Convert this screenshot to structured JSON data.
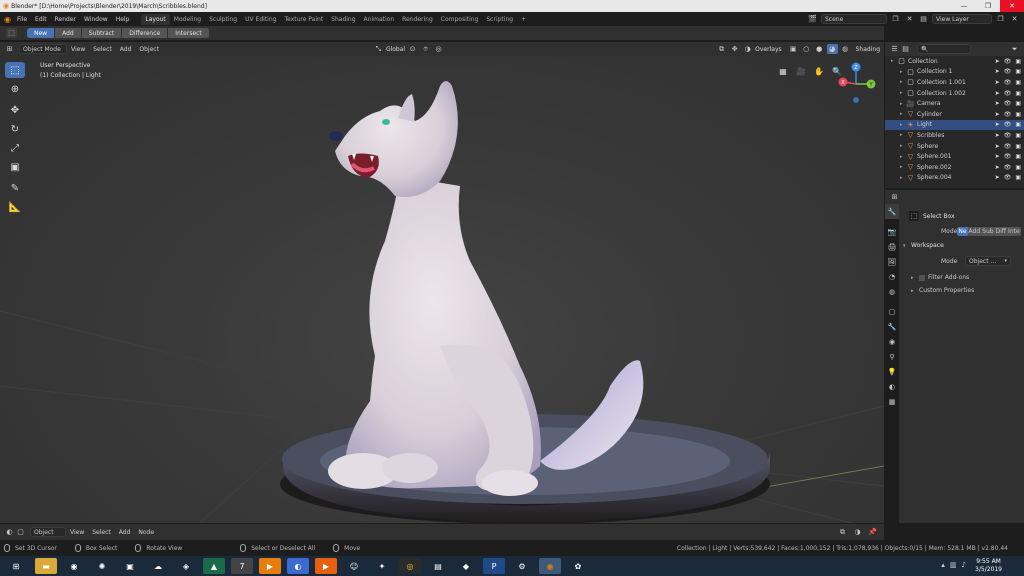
{
  "window": {
    "title": "Blender* [D:\\Home\\Projects\\Blender\\2019\\March\\Scribbles.blend]",
    "controls": [
      "—",
      "❐",
      "✕"
    ]
  },
  "topbar": {
    "menus": [
      "File",
      "Edit",
      "Render",
      "Window",
      "Help"
    ],
    "workspaces": [
      "Layout",
      "Modeling",
      "Sculpting",
      "UV Editing",
      "Texture Paint",
      "Shading",
      "Animation",
      "Rendering",
      "Compositing",
      "Scripting"
    ],
    "add_tab": "+",
    "scene": "Scene",
    "view_layer": "View Layer"
  },
  "tool_header": {
    "modes": [
      "New",
      "Add",
      "Subtract",
      "Difference",
      "Intersect"
    ]
  },
  "viewport_header": {
    "mode": "Object Mode",
    "menus": [
      "View",
      "Select",
      "Add",
      "Object"
    ],
    "orientation": "Global",
    "overlays": "Overlays",
    "shading": "Shading"
  },
  "viewport": {
    "perspective": "User Perspective",
    "collection_info": "(1) Collection | Light",
    "gizmo": {
      "x": "X",
      "y": "Y",
      "z": "Z"
    }
  },
  "bottom_header": {
    "mode": "Object",
    "menus": [
      "View",
      "Select",
      "Add",
      "Node"
    ]
  },
  "statusbar": {
    "items": [
      "Set 3D Cursor",
      "Box Select",
      "Rotate View",
      "Select or Deselect All",
      "Move"
    ],
    "info": "Collection | Light | Verts:539,642 | Faces:1,000,152 | Tris:1,078,936 | Objects:0/15 | Mem: 528.1 MB | v2.80.44"
  },
  "outliner": {
    "rows": [
      {
        "name": "Collection",
        "icon": "collection-icon",
        "depth": 0,
        "selected": false
      },
      {
        "name": "Collection 1",
        "icon": "collection-icon",
        "depth": 1,
        "selected": false
      },
      {
        "name": "Collection 1.001",
        "icon": "collection-icon",
        "depth": 1,
        "selected": false
      },
      {
        "name": "Collection 1.002",
        "icon": "collection-icon",
        "depth": 1,
        "selected": false
      },
      {
        "name": "Camera",
        "icon": "camera-icon",
        "depth": 1,
        "selected": false
      },
      {
        "name": "Cylinder",
        "icon": "mesh-icon",
        "depth": 1,
        "selected": false
      },
      {
        "name": "Light",
        "icon": "light-icon",
        "depth": 1,
        "selected": true
      },
      {
        "name": "Scribbles",
        "icon": "mesh-icon",
        "depth": 1,
        "selected": false
      },
      {
        "name": "Sphere",
        "icon": "mesh-icon",
        "depth": 1,
        "selected": false
      },
      {
        "name": "Sphere.001",
        "icon": "mesh-icon",
        "depth": 1,
        "selected": false
      },
      {
        "name": "Sphere.002",
        "icon": "mesh-icon",
        "depth": 1,
        "selected": false
      },
      {
        "name": "Sphere.004",
        "icon": "mesh-icon",
        "depth": 1,
        "selected": false
      }
    ]
  },
  "properties": {
    "tool_name": "Select Box",
    "mode_label": "Mode",
    "mode_buttons": [
      "Ne",
      "Add",
      "Sub",
      "Diff",
      "Inte"
    ],
    "workspace_section": "Workspace",
    "workspace_mode_label": "Mode",
    "workspace_mode_value": "Object ...",
    "filter_addons": "Filter Add-ons",
    "custom_properties": "Custom Properties"
  },
  "taskbar": {
    "time": "9:55 AM",
    "date": "3/5/2019"
  },
  "colors": {
    "accent": "#4772b3",
    "selected_row": "#334d80",
    "axis_x": "#e8485a",
    "axis_y": "#7cc53e",
    "axis_z": "#3f8ee8"
  }
}
